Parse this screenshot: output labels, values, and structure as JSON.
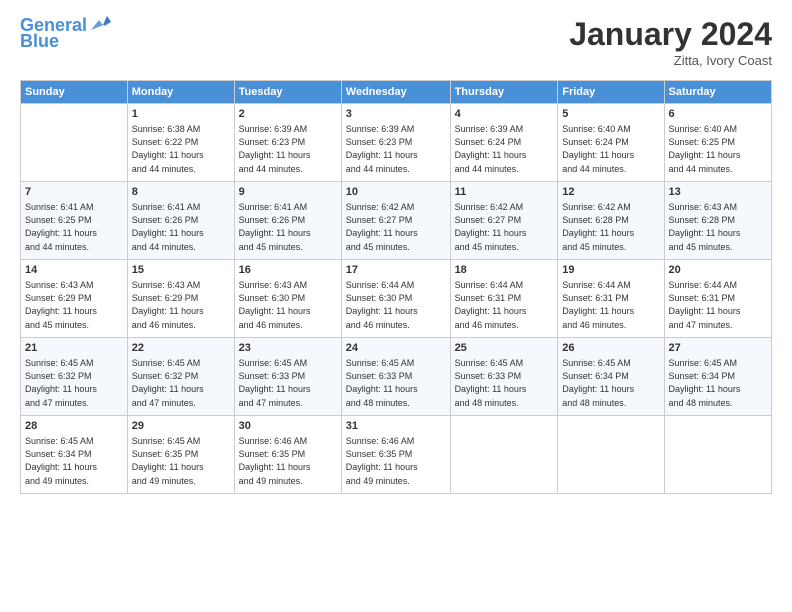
{
  "header": {
    "logo_line1": "General",
    "logo_line2": "Blue",
    "month": "January 2024",
    "location": "Zitta, Ivory Coast"
  },
  "days_of_week": [
    "Sunday",
    "Monday",
    "Tuesday",
    "Wednesday",
    "Thursday",
    "Friday",
    "Saturday"
  ],
  "weeks": [
    [
      {
        "day": "",
        "info": ""
      },
      {
        "day": "1",
        "info": "Sunrise: 6:38 AM\nSunset: 6:22 PM\nDaylight: 11 hours\nand 44 minutes."
      },
      {
        "day": "2",
        "info": "Sunrise: 6:39 AM\nSunset: 6:23 PM\nDaylight: 11 hours\nand 44 minutes."
      },
      {
        "day": "3",
        "info": "Sunrise: 6:39 AM\nSunset: 6:23 PM\nDaylight: 11 hours\nand 44 minutes."
      },
      {
        "day": "4",
        "info": "Sunrise: 6:39 AM\nSunset: 6:24 PM\nDaylight: 11 hours\nand 44 minutes."
      },
      {
        "day": "5",
        "info": "Sunrise: 6:40 AM\nSunset: 6:24 PM\nDaylight: 11 hours\nand 44 minutes."
      },
      {
        "day": "6",
        "info": "Sunrise: 6:40 AM\nSunset: 6:25 PM\nDaylight: 11 hours\nand 44 minutes."
      }
    ],
    [
      {
        "day": "7",
        "info": "Sunrise: 6:41 AM\nSunset: 6:25 PM\nDaylight: 11 hours\nand 44 minutes."
      },
      {
        "day": "8",
        "info": "Sunrise: 6:41 AM\nSunset: 6:26 PM\nDaylight: 11 hours\nand 44 minutes."
      },
      {
        "day": "9",
        "info": "Sunrise: 6:41 AM\nSunset: 6:26 PM\nDaylight: 11 hours\nand 45 minutes."
      },
      {
        "day": "10",
        "info": "Sunrise: 6:42 AM\nSunset: 6:27 PM\nDaylight: 11 hours\nand 45 minutes."
      },
      {
        "day": "11",
        "info": "Sunrise: 6:42 AM\nSunset: 6:27 PM\nDaylight: 11 hours\nand 45 minutes."
      },
      {
        "day": "12",
        "info": "Sunrise: 6:42 AM\nSunset: 6:28 PM\nDaylight: 11 hours\nand 45 minutes."
      },
      {
        "day": "13",
        "info": "Sunrise: 6:43 AM\nSunset: 6:28 PM\nDaylight: 11 hours\nand 45 minutes."
      }
    ],
    [
      {
        "day": "14",
        "info": "Sunrise: 6:43 AM\nSunset: 6:29 PM\nDaylight: 11 hours\nand 45 minutes."
      },
      {
        "day": "15",
        "info": "Sunrise: 6:43 AM\nSunset: 6:29 PM\nDaylight: 11 hours\nand 46 minutes."
      },
      {
        "day": "16",
        "info": "Sunrise: 6:43 AM\nSunset: 6:30 PM\nDaylight: 11 hours\nand 46 minutes."
      },
      {
        "day": "17",
        "info": "Sunrise: 6:44 AM\nSunset: 6:30 PM\nDaylight: 11 hours\nand 46 minutes."
      },
      {
        "day": "18",
        "info": "Sunrise: 6:44 AM\nSunset: 6:31 PM\nDaylight: 11 hours\nand 46 minutes."
      },
      {
        "day": "19",
        "info": "Sunrise: 6:44 AM\nSunset: 6:31 PM\nDaylight: 11 hours\nand 46 minutes."
      },
      {
        "day": "20",
        "info": "Sunrise: 6:44 AM\nSunset: 6:31 PM\nDaylight: 11 hours\nand 47 minutes."
      }
    ],
    [
      {
        "day": "21",
        "info": "Sunrise: 6:45 AM\nSunset: 6:32 PM\nDaylight: 11 hours\nand 47 minutes."
      },
      {
        "day": "22",
        "info": "Sunrise: 6:45 AM\nSunset: 6:32 PM\nDaylight: 11 hours\nand 47 minutes."
      },
      {
        "day": "23",
        "info": "Sunrise: 6:45 AM\nSunset: 6:33 PM\nDaylight: 11 hours\nand 47 minutes."
      },
      {
        "day": "24",
        "info": "Sunrise: 6:45 AM\nSunset: 6:33 PM\nDaylight: 11 hours\nand 48 minutes."
      },
      {
        "day": "25",
        "info": "Sunrise: 6:45 AM\nSunset: 6:33 PM\nDaylight: 11 hours\nand 48 minutes."
      },
      {
        "day": "26",
        "info": "Sunrise: 6:45 AM\nSunset: 6:34 PM\nDaylight: 11 hours\nand 48 minutes."
      },
      {
        "day": "27",
        "info": "Sunrise: 6:45 AM\nSunset: 6:34 PM\nDaylight: 11 hours\nand 48 minutes."
      }
    ],
    [
      {
        "day": "28",
        "info": "Sunrise: 6:45 AM\nSunset: 6:34 PM\nDaylight: 11 hours\nand 49 minutes."
      },
      {
        "day": "29",
        "info": "Sunrise: 6:45 AM\nSunset: 6:35 PM\nDaylight: 11 hours\nand 49 minutes."
      },
      {
        "day": "30",
        "info": "Sunrise: 6:46 AM\nSunset: 6:35 PM\nDaylight: 11 hours\nand 49 minutes."
      },
      {
        "day": "31",
        "info": "Sunrise: 6:46 AM\nSunset: 6:35 PM\nDaylight: 11 hours\nand 49 minutes."
      },
      {
        "day": "",
        "info": ""
      },
      {
        "day": "",
        "info": ""
      },
      {
        "day": "",
        "info": ""
      }
    ]
  ]
}
